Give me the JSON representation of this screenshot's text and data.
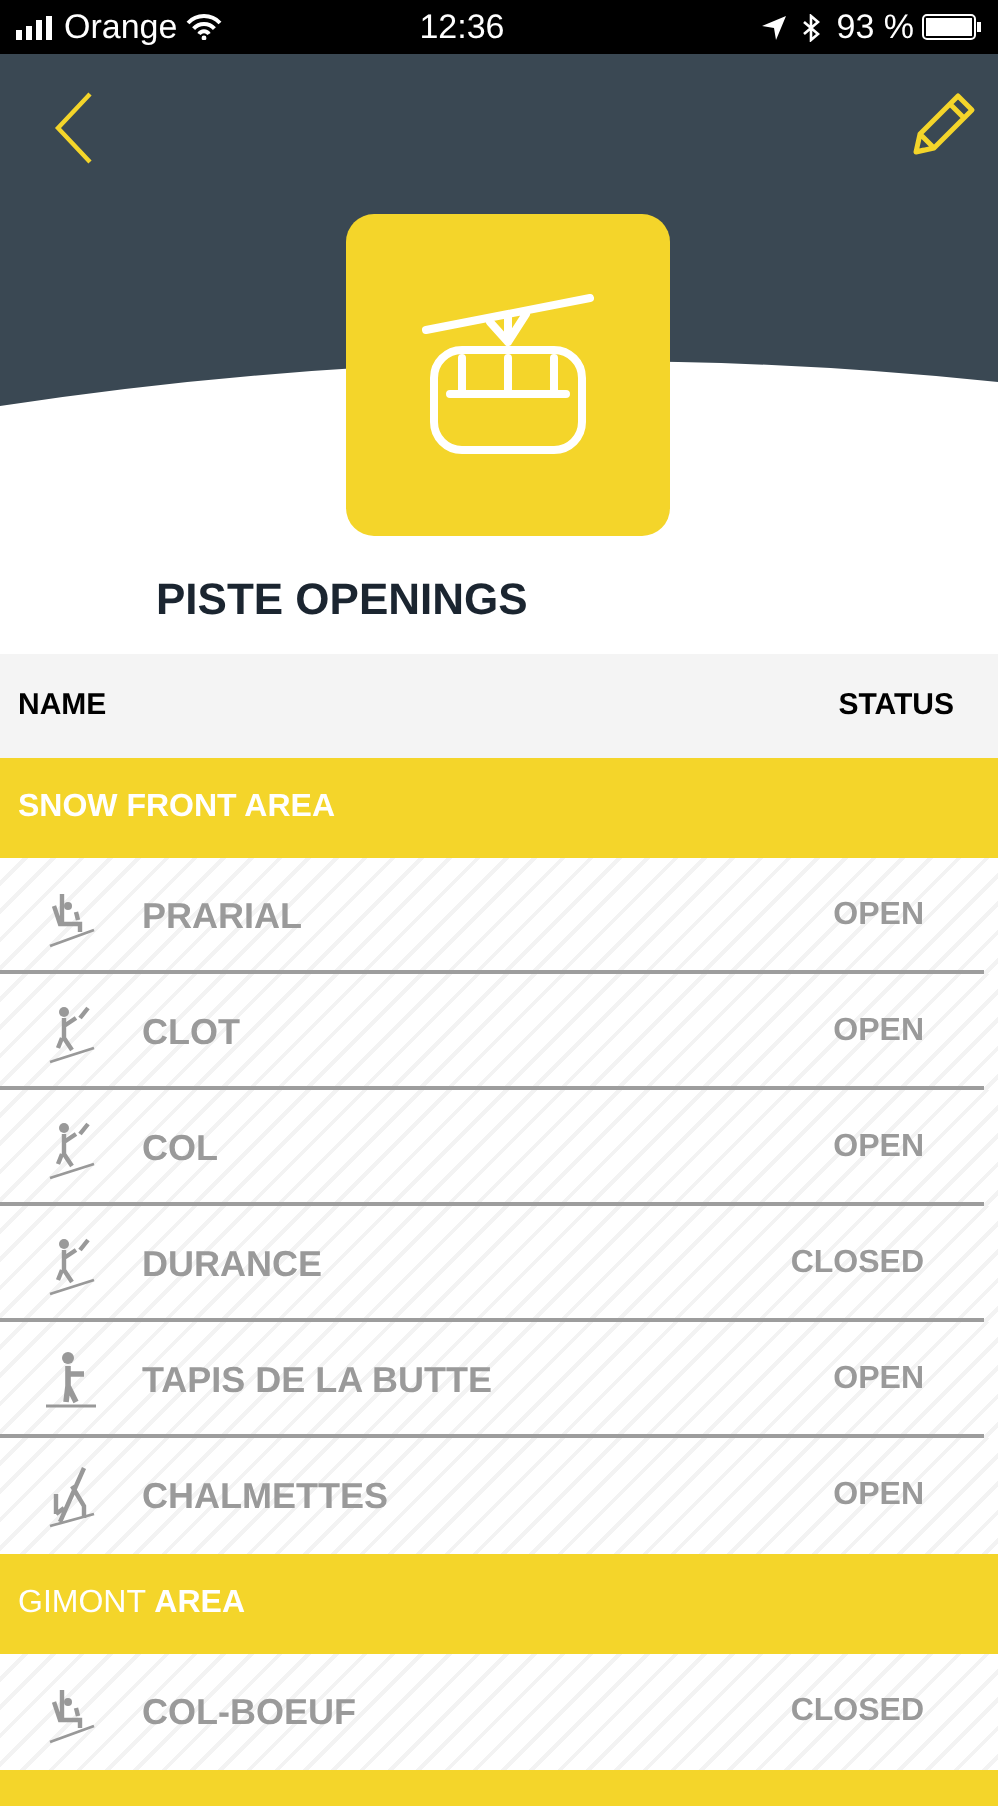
{
  "status_bar": {
    "carrier": "Orange",
    "time": "12:36",
    "battery": "93 %"
  },
  "title": "PISTE OPENINGS",
  "columns": [
    "NAME",
    "STATUS"
  ],
  "sections": [
    {
      "title": "SNOW FRONT AREA",
      "bold": true,
      "rows": [
        {
          "kind": "chairlift",
          "name": "PRARIAL",
          "status": "OPEN"
        },
        {
          "kind": "draglift",
          "name": "CLOT",
          "status": "OPEN"
        },
        {
          "kind": "draglift",
          "name": "COL",
          "status": "OPEN"
        },
        {
          "kind": "draglift",
          "name": "DURANCE",
          "status": "CLOSED"
        },
        {
          "kind": "carpet",
          "name": "TAPIS DE LA BUTTE",
          "status": "OPEN"
        },
        {
          "kind": "rope",
          "name": "CHALMETTES",
          "status": "OPEN"
        }
      ]
    },
    {
      "title": "GIMONT **AREA**",
      "bold": false,
      "rows": [
        {
          "kind": "chairlift",
          "name": "COL-BOEUF",
          "status": "CLOSED"
        }
      ]
    }
  ]
}
